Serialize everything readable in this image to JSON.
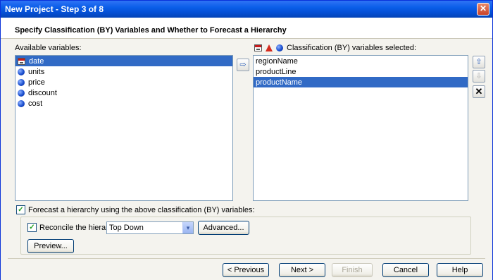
{
  "window": {
    "title": "New Project - Step 3 of 8",
    "close_glyph": "✕"
  },
  "header": {
    "text": "Specify Classification (BY) Variables and Whether to Forecast a Hierarchy"
  },
  "available": {
    "label": "Available variables:",
    "items": [
      {
        "name": "date",
        "icon": "calendar-icon",
        "selected": true
      },
      {
        "name": "units",
        "icon": "numeric-ball-icon",
        "selected": false
      },
      {
        "name": "price",
        "icon": "numeric-ball-icon",
        "selected": false
      },
      {
        "name": "discount",
        "icon": "numeric-ball-icon",
        "selected": false
      },
      {
        "name": "cost",
        "icon": "numeric-ball-icon",
        "selected": false
      }
    ]
  },
  "move_right_glyph": "⇨",
  "classification": {
    "label": "Classification (BY) variables selected:",
    "items": [
      {
        "name": "regionName",
        "selected": false
      },
      {
        "name": "productLine",
        "selected": false
      },
      {
        "name": "productName",
        "selected": true
      }
    ]
  },
  "side_buttons": {
    "up_glyph": "⇧",
    "down_glyph": "⇩",
    "remove_glyph": "✕"
  },
  "forecast_hierarchy": {
    "label": "Forecast a hierarchy using the above classification (BY) variables:",
    "checked": true,
    "check_glyph": "✓"
  },
  "reconcile": {
    "label": "Reconcile the hierarchy",
    "checked": true,
    "check_glyph": "✓",
    "method": "Top Down",
    "dropdown_glyph": "▾",
    "advanced_label": "Advanced..."
  },
  "preview_label": "Preview...",
  "footer": {
    "previous_label": "< Previous",
    "next_label": "Next >",
    "finish_label": "Finish",
    "cancel_label": "Cancel",
    "help_label": "Help"
  }
}
